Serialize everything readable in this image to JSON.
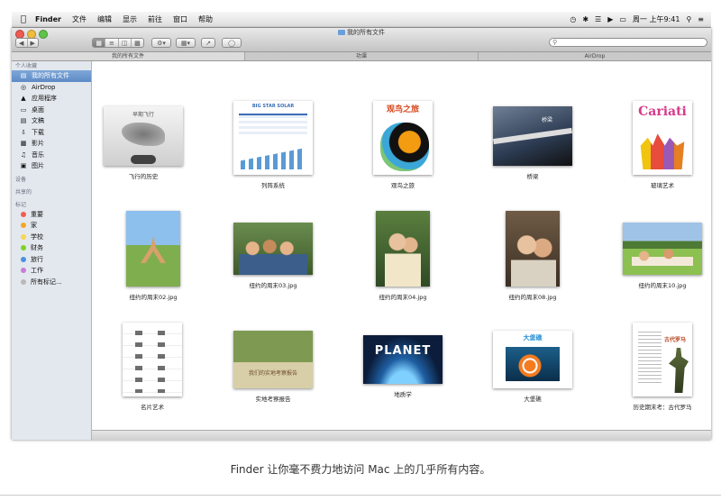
{
  "menubar": {
    "apple_icon": "apple-logo-icon",
    "items": [
      "Finder",
      "文件",
      "编辑",
      "显示",
      "前往",
      "窗口",
      "帮助"
    ],
    "clock": "周一 上午9:41",
    "status_icons": [
      "time-machine-icon",
      "bluetooth-icon",
      "wifi-icon",
      "volume-icon",
      "battery-icon",
      "spotlight-icon",
      "notification-list-icon"
    ]
  },
  "window": {
    "title": "我的所有文件",
    "toolbar": {
      "view_modes": [
        "icon-view-icon",
        "list-view-icon",
        "column-view-icon",
        "cover-flow-icon"
      ],
      "action_icon": "gear-icon",
      "arrange_icon": "arrange-icon",
      "share_icon": "share-icon",
      "tag_icon": "tag-icon",
      "search_icon": "search-icon"
    },
    "tabs": [
      "我的所有文件",
      "功课",
      "AirDrop"
    ],
    "active_tab": 0
  },
  "sidebar": {
    "favorites_header": "个人收藏",
    "favorites": [
      {
        "label": "我的所有文件",
        "icon": "all-files-icon",
        "selected": true
      },
      {
        "label": "AirDrop",
        "icon": "airdrop-icon",
        "selected": false
      },
      {
        "label": "应用程序",
        "icon": "applications-icon",
        "selected": false
      },
      {
        "label": "桌面",
        "icon": "desktop-icon",
        "selected": false
      },
      {
        "label": "文稿",
        "icon": "documents-icon",
        "selected": false
      },
      {
        "label": "下载",
        "icon": "downloads-icon",
        "selected": false
      },
      {
        "label": "影片",
        "icon": "movies-icon",
        "selected": false
      },
      {
        "label": "音乐",
        "icon": "music-icon",
        "selected": false
      },
      {
        "label": "图片",
        "icon": "pictures-icon",
        "selected": false
      }
    ],
    "devices_header": "设备",
    "shared_header": "共享的",
    "tags_header": "标记",
    "tags": [
      {
        "label": "重要",
        "color": "#f25c54"
      },
      {
        "label": "家",
        "color": "#f5a623"
      },
      {
        "label": "学校",
        "color": "#f8d64e"
      },
      {
        "label": "财务",
        "color": "#7ed321"
      },
      {
        "label": "旅行",
        "color": "#4a90e2"
      },
      {
        "label": "工作",
        "color": "#c77dd8"
      },
      {
        "label": "所有标记...",
        "color": "#b9b9b9"
      }
    ]
  },
  "files": [
    {
      "name": "飞行的历史",
      "overlay": "早期飞行",
      "kind": "keynote"
    },
    {
      "name": "列阵系统",
      "overlay": "BIG STAR SOLAR",
      "kind": "numbers"
    },
    {
      "name": "观鸟之旅",
      "overlay": "观鸟之旅",
      "kind": "bird"
    },
    {
      "name": "桥梁",
      "overlay": "桥梁",
      "kind": "bridge"
    },
    {
      "name": "玻璃艺术",
      "overlay": "Cariati",
      "kind": "glass"
    },
    {
      "name": "纽约的周末02.jpg",
      "overlay": "",
      "kind": "photo-yoga"
    },
    {
      "name": "纽约的周末03.jpg",
      "overlay": "",
      "kind": "photo-group"
    },
    {
      "name": "纽约的周末04.jpg",
      "overlay": "",
      "kind": "photo-women"
    },
    {
      "name": "纽约的周末08.jpg",
      "overlay": "",
      "kind": "photo-two"
    },
    {
      "name": "纽约的周末10.jpg",
      "overlay": "",
      "kind": "photo-park"
    },
    {
      "name": "名片艺术",
      "overlay": "",
      "kind": "cards"
    },
    {
      "name": "实地考察报告",
      "overlay": "我们的实地考察报告",
      "kind": "report"
    },
    {
      "name": "地质学",
      "overlay": "PLANET",
      "kind": "planet"
    },
    {
      "name": "大堡礁",
      "overlay": "大堡礁",
      "kind": "reef"
    },
    {
      "name": "历史期末考：古代罗马",
      "overlay": "古代罗马",
      "kind": "rome"
    }
  ],
  "caption": "Finder 让你毫不费力地访问 Mac 上的几乎所有内容。"
}
